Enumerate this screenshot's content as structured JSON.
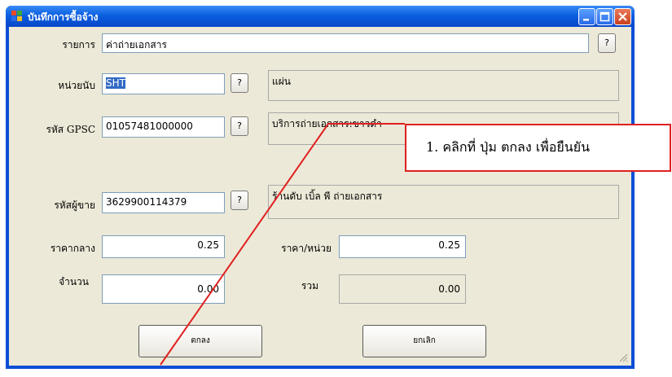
{
  "window": {
    "title": "บันทึกการซื้อจ้าง"
  },
  "form": {
    "item_label": "รายการ",
    "item_value": "ค่าถ่ายเอกสาร",
    "unit_label": "หน่วยนับ",
    "unit_code": "SHT",
    "unit_name": "แผ่น",
    "gpsc_label": "รหัส GPSC",
    "gpsc_code": "01057481000000",
    "gpsc_desc": "บริการถ่ายเอกสาร:ขาวดำ",
    "vendor_label": "รหัสผู้ขาย",
    "vendor_code": "3629900114379",
    "vendor_name": "ร้านดับ เบิ้ล พี ถ่ายเอกสาร",
    "median_price_label": "ราคากลาง",
    "median_price": "0.25",
    "unit_price_label": "ราคา/หน่วย",
    "unit_price": "0.25",
    "quantity_label": "จำนวน",
    "quantity": "0.00",
    "total_label": "รวม",
    "total": "0.00",
    "lookup_symbol": "?"
  },
  "buttons": {
    "ok": "ตกลง",
    "cancel": "ยกเลิก"
  },
  "callout": {
    "text": "1. คลิกที่ ปุ่ม ตกลง เพื่อยืนยัน"
  },
  "colors": {
    "accent": "#e02020",
    "titlebar": "#0a5fe0",
    "selection": "#316ac5"
  }
}
